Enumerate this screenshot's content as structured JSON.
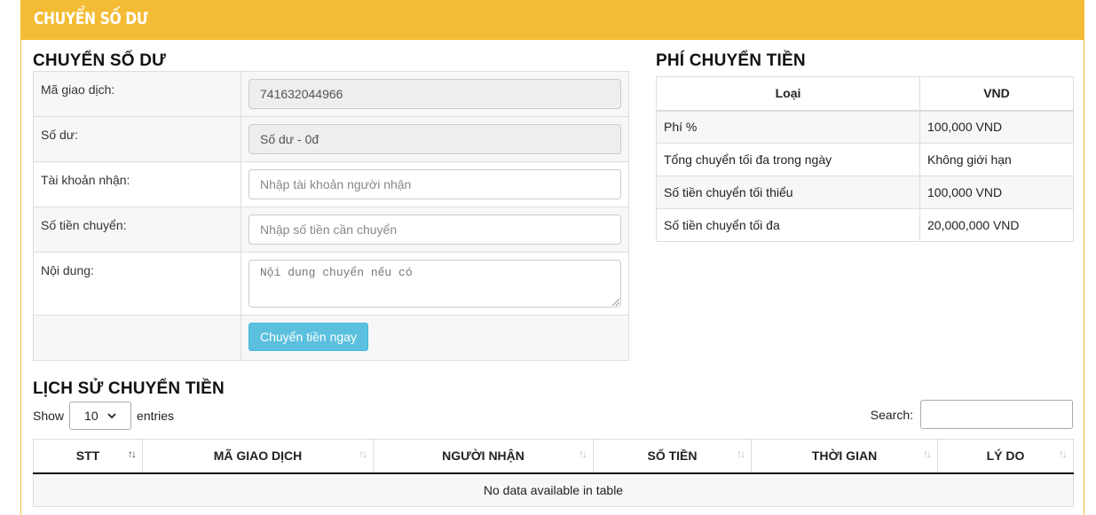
{
  "panel": {
    "title": "CHUYỂN SỐ DƯ"
  },
  "transfer": {
    "title": "CHUYỂN SỐ DƯ",
    "rows": [
      {
        "label": "Mã giao dịch:",
        "value": "741632044966"
      },
      {
        "label": "Số dư:",
        "value": "Số dư - 0đ"
      },
      {
        "label": "Tài khoản nhận:",
        "placeholder": "Nhập tài khoản người nhận"
      },
      {
        "label": "Số tiền chuyển:",
        "placeholder": "Nhập số tiền cần chuyển"
      },
      {
        "label": "Nội dung:",
        "placeholder": "Nội dung chuyển nếu có"
      }
    ],
    "submit_label": "Chuyển tiền ngay"
  },
  "fees": {
    "title": "PHÍ CHUYỂN TIỀN",
    "headers": [
      "Loại",
      "VND"
    ],
    "rows": [
      [
        "Phí %",
        "100,000 VND"
      ],
      [
        "Tổng chuyển tối đa trong ngày",
        "Không giới hạn"
      ],
      [
        "Số tiền chuyển tối thiểu",
        "100,000 VND"
      ],
      [
        "Số tiền chuyển tối đa",
        "20,000,000 VND"
      ]
    ]
  },
  "history": {
    "title": "LỊCH SỬ CHUYỂN TIỀN",
    "show_label": "Show",
    "entries_label": "entries",
    "page_length": "10",
    "search_label": "Search:",
    "columns": [
      "STT",
      "MÃ GIAO DỊCH",
      "NGƯỜI NHẬN",
      "SỐ TIỀN",
      "THỜI GIAN",
      "LÝ DO"
    ],
    "empty_message": "No data available in table"
  }
}
